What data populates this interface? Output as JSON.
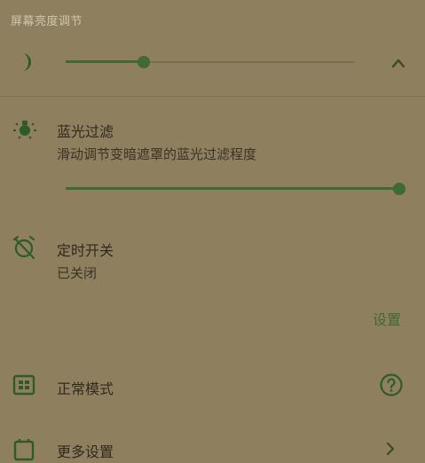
{
  "header": {
    "title": "屏幕亮度调节"
  },
  "brightness": {
    "level": 0.27
  },
  "blue_filter": {
    "title": "蓝光过滤",
    "subtitle": "滑动调节变暗遮罩的蓝光过滤程度",
    "level": 1.0
  },
  "timer": {
    "title": "定时开关",
    "status": "已关闭",
    "settings_label": "设置"
  },
  "normal_mode": {
    "label": "正常模式"
  },
  "more_settings": {
    "label": "更多设置"
  },
  "colors": {
    "accent": "#3f6a33",
    "background": "#8e7f5e"
  }
}
